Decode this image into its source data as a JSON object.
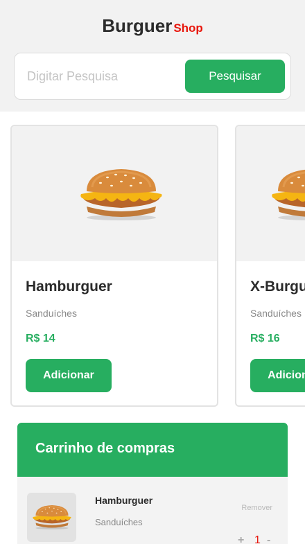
{
  "header": {
    "brand_main": "Burguer",
    "brand_sub": "Shop"
  },
  "search": {
    "placeholder": "Digitar Pesquisa",
    "value": "",
    "button_label": "Pesquisar"
  },
  "products": [
    {
      "name": "Hamburguer",
      "category": "Sanduíches",
      "price": "R$ 14",
      "button_label": "Adicionar"
    },
    {
      "name": "X-Burguer",
      "category": "Sanduíches",
      "price": "R$ 16",
      "button_label": "Adicionar"
    }
  ],
  "cart": {
    "title": "Carrinho de compras",
    "items": [
      {
        "name": "Hamburguer",
        "category": "Sanduíches",
        "remove_label": "Remover",
        "plus": "+",
        "quantity": "1",
        "minus": "-"
      }
    ]
  },
  "colors": {
    "accent": "#27ae60",
    "brand_red": "#e8160c",
    "background_top": "#f2f2f2"
  },
  "icons": {
    "product_image": "burger-image"
  }
}
